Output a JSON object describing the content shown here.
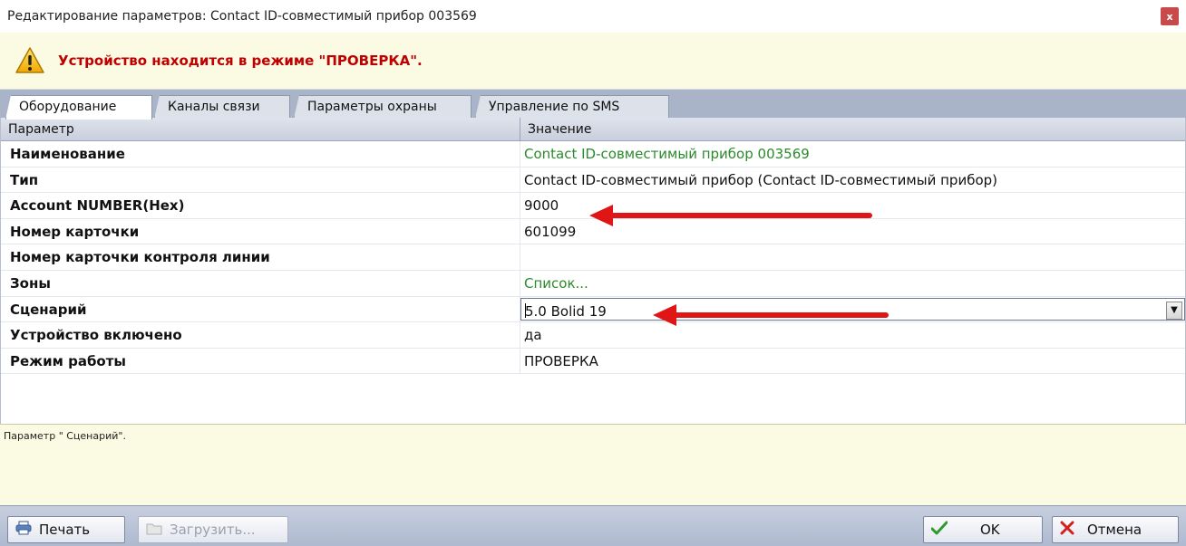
{
  "window": {
    "title": "Редактирование параметров: Contact ID-совместимый прибор 003569",
    "close_label": "x"
  },
  "warning": {
    "text": "Устройство находится в режиме \"ПРОВЕРКА\".",
    "icon": "warning-triangle-icon"
  },
  "tabs": [
    {
      "label": "Оборудование",
      "active": true
    },
    {
      "label": "Каналы связи",
      "active": false
    },
    {
      "label": "Параметры охраны",
      "active": false
    },
    {
      "label": "Управление по SMS",
      "active": false
    }
  ],
  "grid": {
    "headers": {
      "param": "Параметр",
      "value": "Значение"
    },
    "rows": [
      {
        "param": "Наименование",
        "value": "Contact ID-совместимый прибор 003569",
        "value_color": "green"
      },
      {
        "param": "Тип",
        "value": "Contact ID-совместимый прибор   (Contact ID-совместимый прибор)"
      },
      {
        "param": "Account NUMBER(Hex)",
        "value": "9000"
      },
      {
        "param": "Номер карточки",
        "value": "601099"
      },
      {
        "param": "Номер карточки контроля линии",
        "value": ""
      },
      {
        "param": "Зоны",
        "value": "Список...",
        "value_color": "green"
      },
      {
        "param": "Сценарий",
        "value": "5.0 Bolid 19",
        "control": "dropdown"
      },
      {
        "param": "Устройство включено",
        "value": "да"
      },
      {
        "param": "Режим работы",
        "value": "ПРОВЕРКА"
      }
    ]
  },
  "description": {
    "text": "Параметр \" Сценарий\"."
  },
  "footer": {
    "print_label": "Печать",
    "load_label": "Загрузить...",
    "ok_label": "OK",
    "cancel_label": "Отмена"
  },
  "colors": {
    "warning_text": "#c00000",
    "green_value": "#2b8a2b",
    "annotation_arrow": "#e01515",
    "tabstrip_bg": "#a9b4c9",
    "description_bg": "#fbfbe3"
  }
}
